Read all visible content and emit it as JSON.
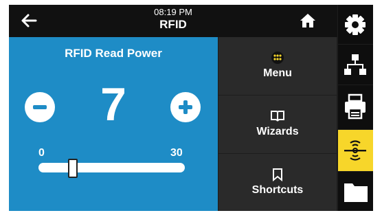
{
  "header": {
    "time": "08:19 PM",
    "title": "RFID"
  },
  "panel": {
    "title": "RFID Read Power",
    "value": "7",
    "slider": {
      "min_label": "0",
      "max_label": "30",
      "min": 0,
      "max": 30,
      "value": 7
    }
  },
  "menu": [
    {
      "label": "Menu",
      "icon": "menu-dots-icon",
      "active": true
    },
    {
      "label": "Wizards",
      "icon": "book-icon",
      "active": false
    },
    {
      "label": "Shortcuts",
      "icon": "bookmark-icon",
      "active": false
    }
  ],
  "sidebar": [
    {
      "icon": "settings-gear-icon",
      "active": false
    },
    {
      "icon": "network-icon",
      "active": false
    },
    {
      "icon": "printer-icon",
      "active": false
    },
    {
      "icon": "rfid-icon",
      "active": true
    },
    {
      "icon": "folder-icon",
      "active": false
    }
  ],
  "colors": {
    "panel": "#1e8cc6",
    "accent": "#f7d62a",
    "menu_bg": "#2a2a2a",
    "header_bg": "#111111"
  }
}
